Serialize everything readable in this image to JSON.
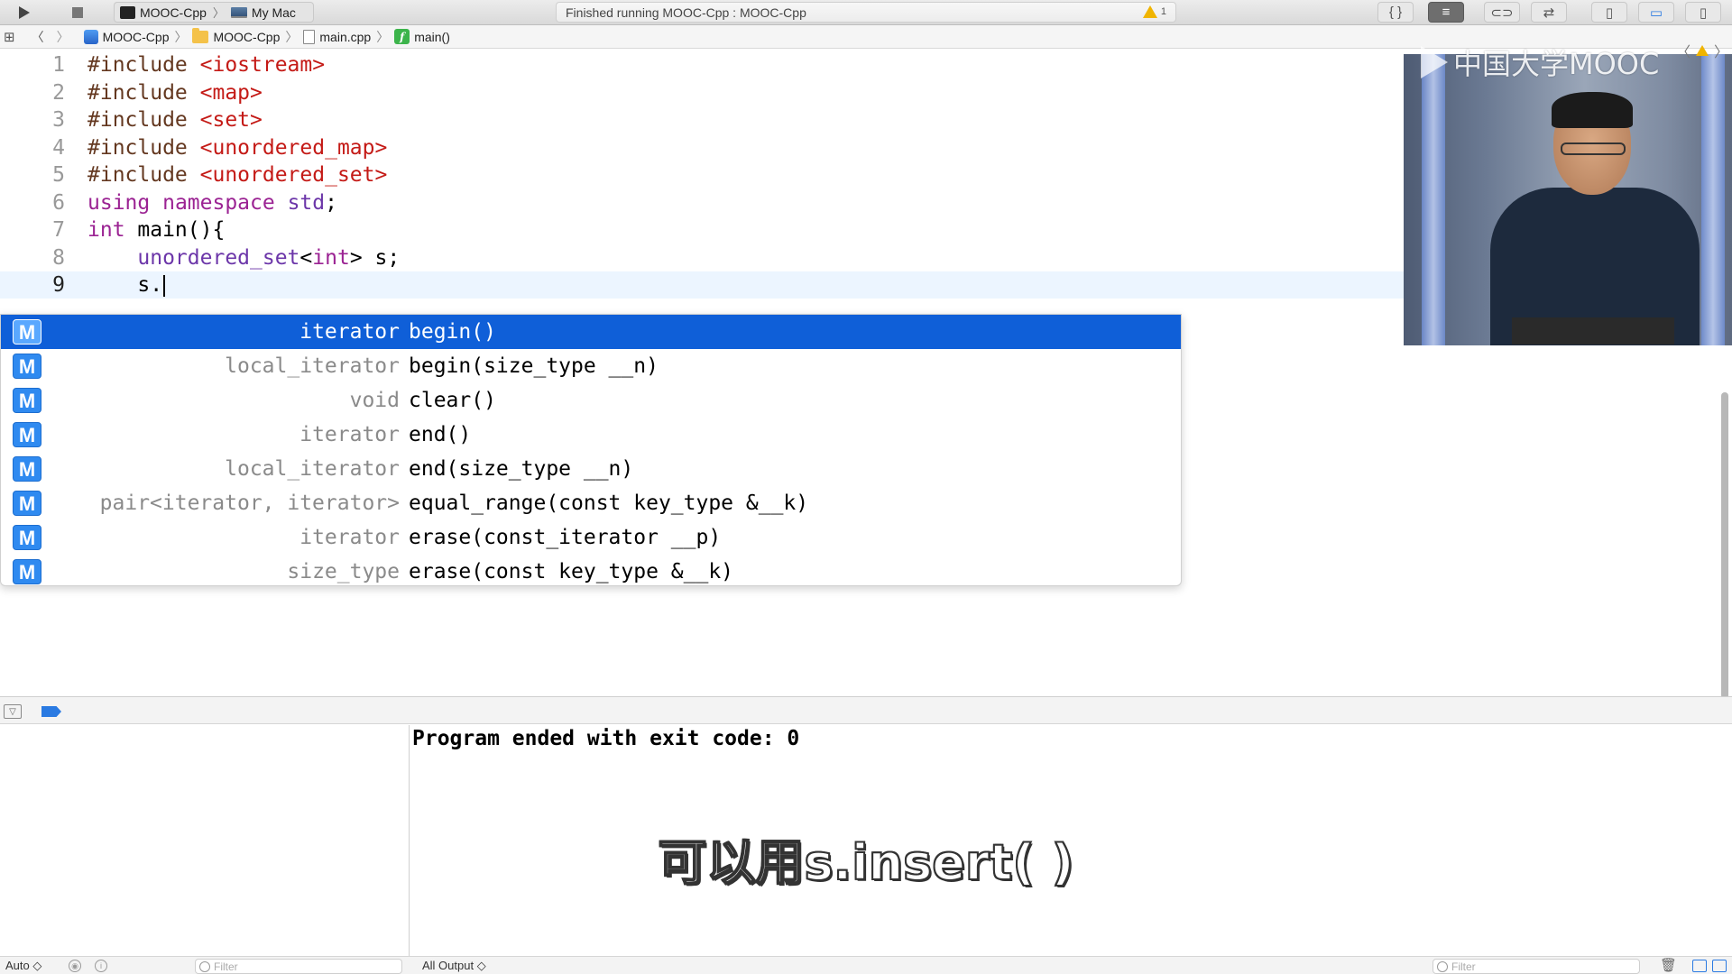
{
  "toolbar": {
    "scheme": "MOOC-Cpp",
    "destination": "My Mac",
    "status": "Finished running MOOC-Cpp : MOOC-Cpp",
    "warning_count": "1",
    "right_buttons": [
      "{ }",
      "≡",
      "⊂⊃",
      "⇄",
      "▯",
      "▭",
      "▯"
    ]
  },
  "jumpbar": {
    "project": "MOOC-Cpp",
    "folder": "MOOC-Cpp",
    "file": "main.cpp",
    "symbol": "main()"
  },
  "editor": {
    "lines": [
      {
        "no": "1",
        "parts": [
          {
            "t": "#include ",
            "c": "pp"
          },
          {
            "t": "<iostream>",
            "c": "str"
          }
        ]
      },
      {
        "no": "2",
        "parts": [
          {
            "t": "#include ",
            "c": "pp"
          },
          {
            "t": "<map>",
            "c": "str"
          }
        ]
      },
      {
        "no": "3",
        "parts": [
          {
            "t": "#include ",
            "c": "pp"
          },
          {
            "t": "<set>",
            "c": "str"
          }
        ]
      },
      {
        "no": "4",
        "parts": [
          {
            "t": "#include ",
            "c": "pp"
          },
          {
            "t": "<unordered_map>",
            "c": "str"
          }
        ]
      },
      {
        "no": "5",
        "parts": [
          {
            "t": "#include ",
            "c": "pp"
          },
          {
            "t": "<unordered_set>",
            "c": "str"
          }
        ]
      },
      {
        "no": "6",
        "parts": [
          {
            "t": "using ",
            "c": "kw"
          },
          {
            "t": "namespace ",
            "c": "kw"
          },
          {
            "t": "std",
            "c": "ty"
          },
          {
            "t": ";",
            "c": "plain"
          }
        ]
      },
      {
        "no": "7",
        "parts": [
          {
            "t": "int ",
            "c": "kw"
          },
          {
            "t": "main(){",
            "c": "plain"
          }
        ]
      },
      {
        "no": "8",
        "parts": [
          {
            "t": "    ",
            "c": "plain"
          },
          {
            "t": "unordered_set",
            "c": "ty"
          },
          {
            "t": "<",
            "c": "plain"
          },
          {
            "t": "int",
            "c": "kw"
          },
          {
            "t": "> s;",
            "c": "plain"
          }
        ]
      },
      {
        "no": "9",
        "parts": [
          {
            "t": "    s.",
            "c": "plain"
          }
        ],
        "current": true
      }
    ]
  },
  "completion": {
    "badge": "M",
    "items": [
      {
        "type": "iterator",
        "name": "begin()",
        "selected": true
      },
      {
        "type": "local_iterator",
        "name": "begin(size_type __n)"
      },
      {
        "type": "void",
        "name": "clear()"
      },
      {
        "type": "iterator",
        "name": "end()"
      },
      {
        "type": "local_iterator",
        "name": "end(size_type __n)"
      },
      {
        "type": "pair<iterator, iterator>",
        "name": "equal_range(const key_type &__k)"
      },
      {
        "type": "iterator",
        "name": "erase(const_iterator __p)"
      },
      {
        "type": "size_type",
        "name": "erase(const key_type &__k)"
      }
    ]
  },
  "overlay": {
    "logo_text": "中国大学MOOC"
  },
  "console": {
    "output": "Program ended with exit code: 0"
  },
  "subtitle": "可以用s.insert( )",
  "bottom": {
    "auto_label": "Auto ◇",
    "filter_placeholder": "Filter",
    "output_select": "All Output ◇",
    "console_filter_placeholder": "Filter"
  },
  "colors": {
    "keyword": "#9b2393",
    "preprocessor": "#643820",
    "string": "#c41a16",
    "type": "#6c36a9",
    "selection": "#0f5fd8"
  }
}
